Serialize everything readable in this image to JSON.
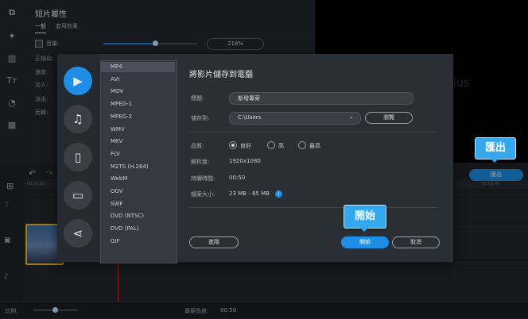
{
  "properties": {
    "title": "短片屬性",
    "tabs": [
      "一般",
      "套用效果"
    ],
    "volume_label": "音量:",
    "volume_value": "218%",
    "volume_level": 0.55,
    "rows": [
      "正規化:",
      "速度:",
      "淡入:",
      "淡出:",
      "反轉:"
    ]
  },
  "preview": {
    "watermark": "ius"
  },
  "export_dialog": {
    "title": "將影片儲存到電腦",
    "formats": [
      "MP4",
      "AVI",
      "MOV",
      "MPEG-1",
      "MPEG-2",
      "WMV",
      "MKV",
      "FLV",
      "M2TS (H.264)",
      "WebM",
      "OGV",
      "SWF",
      "DVD (NTSC)",
      "DVD (PAL)",
      "GIF"
    ],
    "selected_format": "MP4",
    "title_label": "標題:",
    "title_value": "新增專案",
    "save_to_label": "儲存到:",
    "save_to_value": "C:\\Users",
    "browse_label": "瀏覽",
    "quality_label": "品質:",
    "quality_options": [
      "良好",
      "高",
      "最高"
    ],
    "quality_selected": "良好",
    "resolution_label": "解析度:",
    "resolution_value": "1920x1080",
    "duration_label": "持續時間:",
    "duration_value": "00:50",
    "filesize_label": "檔案大小:",
    "filesize_value": "23 MB - 85 MB",
    "info_icon": "i",
    "advanced_label": "進階",
    "start_label": "開始",
    "cancel_label": "取消"
  },
  "callouts": {
    "export": "匯出",
    "start": "開始"
  },
  "timeline": {
    "export_button": "匯出",
    "ruler_start": "00:00:00",
    "ruler_end": "00:00:45"
  },
  "statusbar": {
    "zoom_label": "比例:",
    "project_length_label": "專案長度:",
    "project_length_value": "00:50"
  },
  "colors": {
    "accent": "#1e8ee6",
    "callout": "#35a7ee",
    "clip_border": "#f0c419",
    "playhead": "#d9373b"
  }
}
